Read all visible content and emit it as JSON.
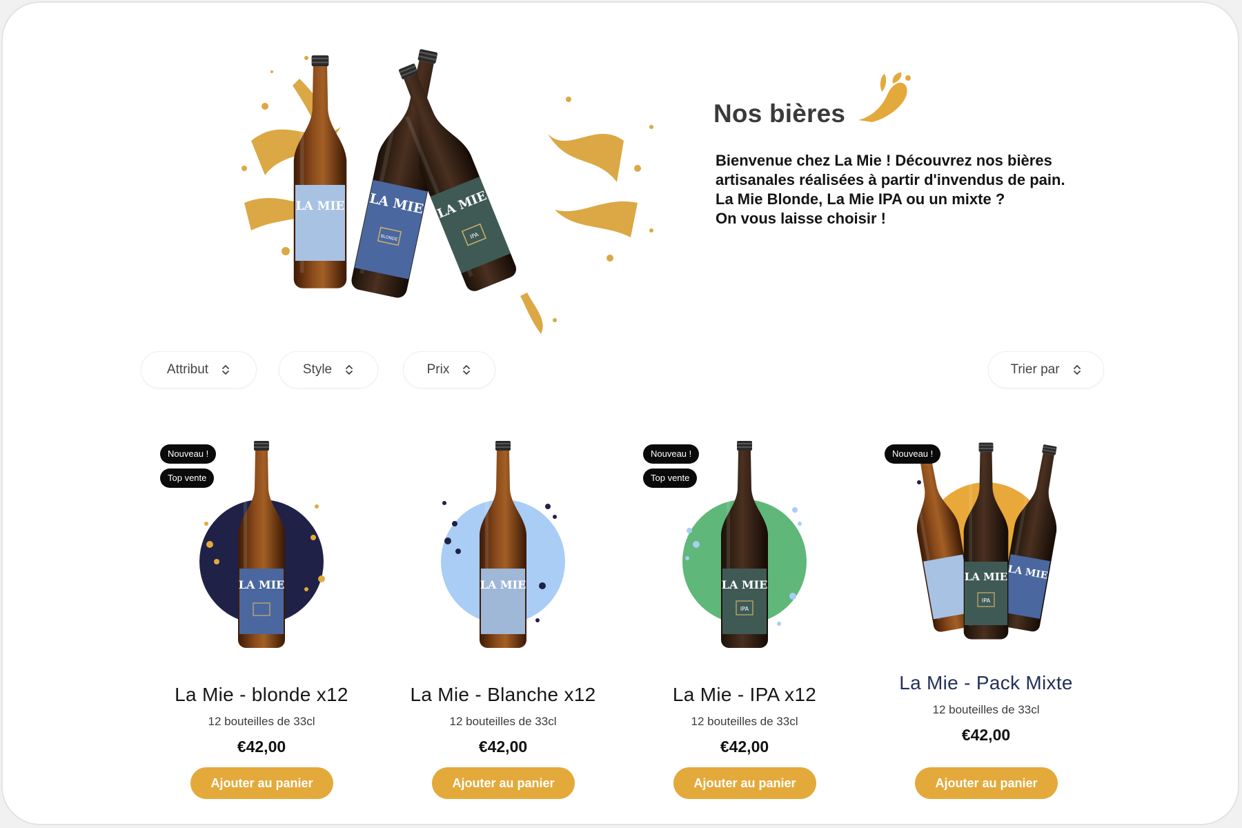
{
  "hero": {
    "title": "Nos bières",
    "intro_lines": [
      "Bienvenue chez La Mie ! Découvrez nos bières artisanales réalisées à partir d'invendus de pain.",
      "La Mie Blonde, La Mie IPA ou un mixte ?",
      "On vous laisse choisir !"
    ],
    "bottle_label_text": "LA MIE",
    "bottle_variants": [
      "BLONDE",
      "IPA"
    ]
  },
  "filters": [
    {
      "label": "Attribut",
      "icon": "chevron-updown-icon"
    },
    {
      "label": "Style",
      "icon": "chevron-updown-icon"
    },
    {
      "label": "Prix",
      "icon": "chevron-updown-icon"
    }
  ],
  "sort": {
    "label": "Trier par",
    "icon": "chevron-updown-icon"
  },
  "products": [
    {
      "name": "La Mie - blonde x12",
      "subtitle": "12 bouteilles de 33cl",
      "price": "€42,00",
      "badges": [
        "Nouveau !",
        "Top vente"
      ],
      "button": "Ajouter au panier",
      "circle_color": "#1f2147",
      "label_color": "#4a679f"
    },
    {
      "name": "La Mie - Blanche x12",
      "subtitle": "12 bouteilles de 33cl",
      "price": "€42,00",
      "badges": [],
      "button": "Ajouter au panier",
      "circle_color": "#a9cdf5",
      "label_color": "#9fb8d8"
    },
    {
      "name": "La Mie - IPA x12",
      "subtitle": "12 bouteilles de 33cl",
      "price": "€42,00",
      "badges": [
        "Nouveau !",
        "Top vente"
      ],
      "button": "Ajouter au panier",
      "circle_color": "#5fb77a",
      "label_color": "#3f5a55"
    },
    {
      "name": "La Mie - Pack Mixte",
      "subtitle": "12 bouteilles de 33cl",
      "price": "€42,00",
      "badges": [
        "Nouveau !"
      ],
      "button": "Ajouter au panier",
      "circle_color": "#e8a93a",
      "label_color": "#4a679f"
    }
  ],
  "colors": {
    "accent": "#e4a93b",
    "badge_bg": "#0a0a0a",
    "amber_bottle": "#6e3812",
    "pack_title": "#23305a"
  }
}
